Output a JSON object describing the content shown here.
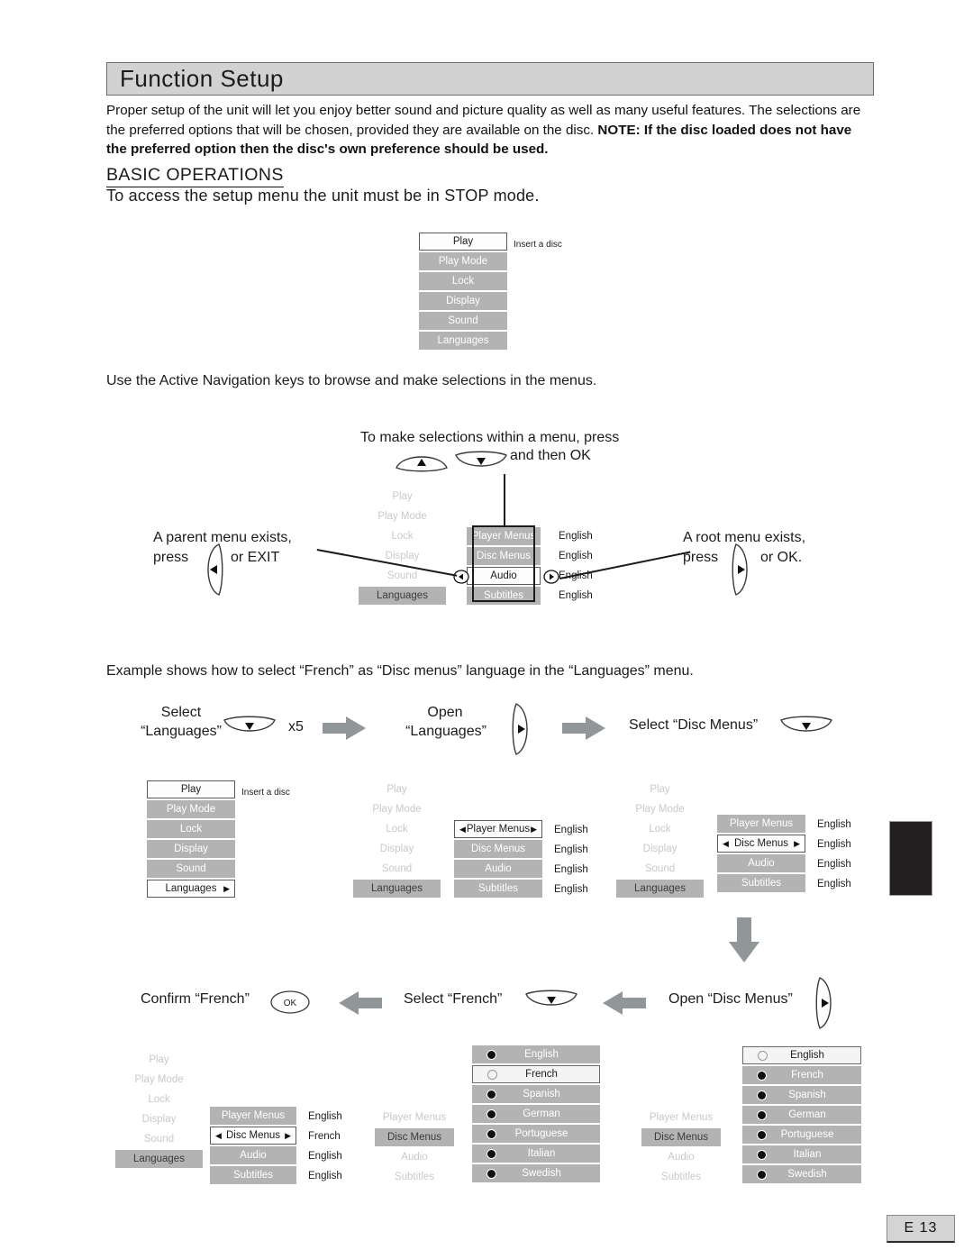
{
  "header": {
    "title": "Function Setup"
  },
  "intro": {
    "normal_1": "Proper setup of the unit will let you enjoy better sound and picture quality as well as many useful features.  The selections are the preferred options that will be chosen, provided they are available on the disc. ",
    "bold_1": "NOTE: If the disc loaded does not have the preferred option then the disc's own preference should be used."
  },
  "section": {
    "heading": "BASIC OPERATIONS",
    "subheading": "To access the setup menu the unit must be in STOP mode."
  },
  "lines": {
    "nav": "Use the Active Navigation keys to browse and make selections in the menus.",
    "example": "Example shows how to select “French” as “Disc menus” language in the “Languages” menu."
  },
  "captions": {
    "make_selections_1": "To make selections within a menu, press",
    "make_selections_2": "and then OK",
    "parent_1": "A parent menu exists,",
    "parent_2": "press",
    "parent_3": "or EXIT",
    "root_1": "A root menu exists,",
    "root_2": "press",
    "root_3": "or OK.",
    "select_languages_1": "Select",
    "select_languages_2": "“Languages”",
    "times_five": "x5",
    "open_languages_1": "Open",
    "open_languages_2": "“Languages”",
    "select_disc_menus": "Select “Disc Menus”",
    "confirm_french": "Confirm “French”",
    "select_french": "Select “French”",
    "open_disc_menus": "Open “Disc Menus”",
    "insert_a_disc": "Insert a disc",
    "ok_label": "OK"
  },
  "main_menu": {
    "items": [
      "Play",
      "Play Mode",
      "Lock",
      "Display",
      "Sound",
      "Languages"
    ]
  },
  "languages_submenu": {
    "items": [
      "Player Menus",
      "Disc Menus",
      "Audio",
      "Subtitles"
    ]
  },
  "values": {
    "all_english": [
      "English",
      "English",
      "English",
      "English"
    ],
    "disc_french": [
      "English",
      "French",
      "English",
      "English"
    ]
  },
  "language_list": {
    "items": [
      "English",
      "French",
      "Spanish",
      "German",
      "Portuguese",
      "Italian",
      "Swedish"
    ]
  },
  "panels": {
    "p1_top": {
      "selected": "Play"
    },
    "p2_nav": {
      "main_selected": "Languages",
      "sub_selected": "Audio"
    },
    "p3_a": {
      "selected": "Languages"
    },
    "p3_b": {
      "main_selected": "Languages",
      "sub_selected": "Player Menus"
    },
    "p3_c": {
      "main_selected": "Languages",
      "sub_selected": "Disc Menus"
    },
    "p4_a": {
      "main_selected": "Languages",
      "sub_selected": "Disc Menus"
    },
    "p4_b": {
      "sub_selected": "Disc Menus",
      "language_selected": "French"
    },
    "p4_c": {
      "sub_selected": "Disc Menus",
      "language_selected": "English"
    }
  },
  "icons": {
    "up_key": "nav-up-key-icon",
    "down_key": "nav-down-key-icon",
    "left_key": "nav-left-key-icon",
    "right_key": "nav-right-key-icon",
    "ok_key": "ok-button-icon",
    "block_arrow_right": "block-arrow-right-icon",
    "block_arrow_left": "block-arrow-left-icon",
    "block_arrow_down": "block-arrow-down-icon"
  },
  "colors": {
    "menu_grey": "#b3b3b3",
    "title_bar": "#d2d2d2",
    "arrow_grey": "#919699",
    "ghost_text": "#c9c9c9",
    "black_tab": "#231f20"
  },
  "footer": {
    "page": "E 13"
  }
}
